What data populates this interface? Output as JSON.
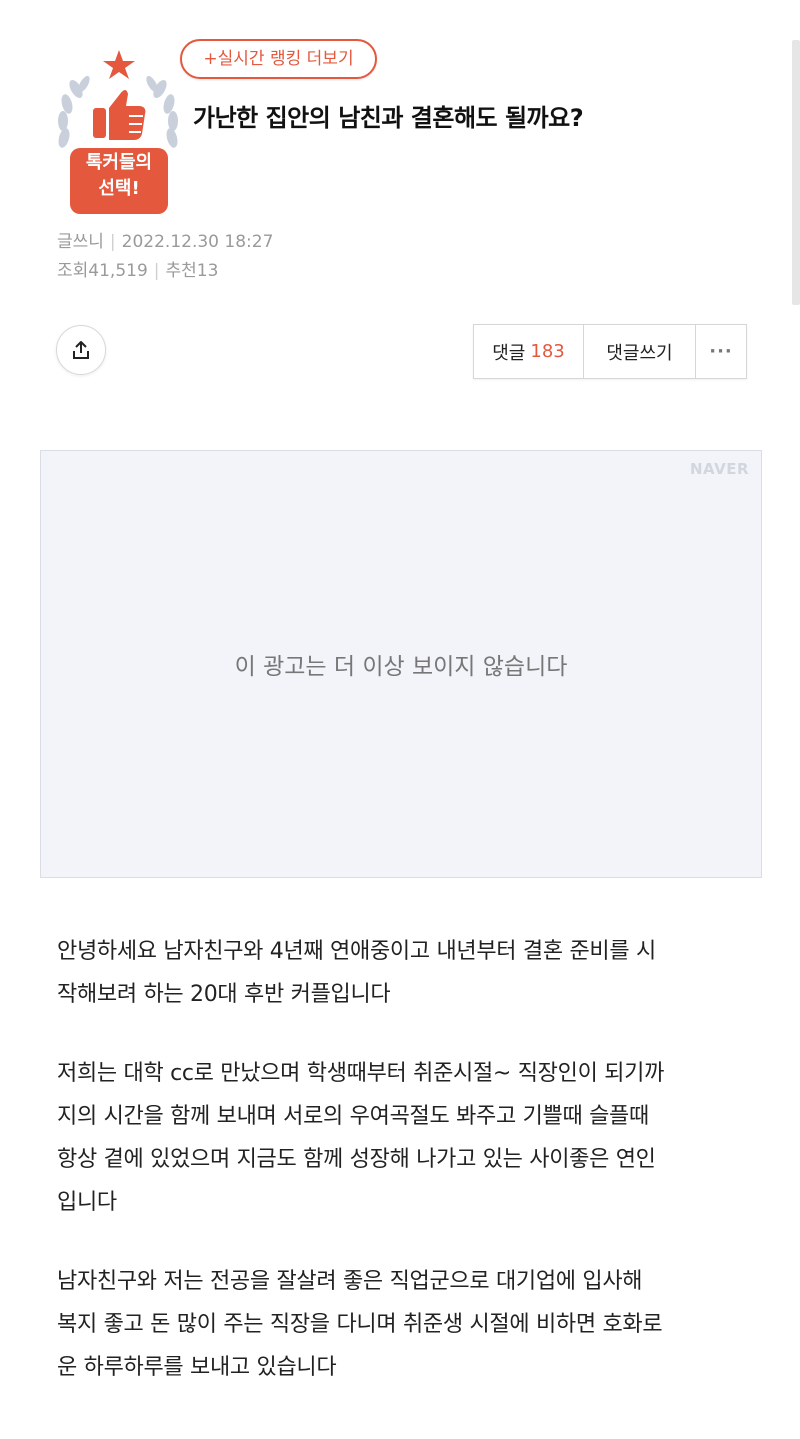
{
  "badge": {
    "line1": "톡커들의",
    "line2": "선택!"
  },
  "ranking_button": "+실시간 랭킹 더보기",
  "post": {
    "title": "가난한 집안의 남친과 결혼해도 될까요?",
    "author_label": "글쓰니",
    "date": "2022.12.30 18:27",
    "views": "조회41,519",
    "recommend": "추천13"
  },
  "actions": {
    "comments_label": "댓글",
    "comments_count": "183",
    "write_comment": "댓글쓰기",
    "more": "···"
  },
  "ad": {
    "logo": "NAVER",
    "message": "이 광고는 더 이상 보이지 않습니다"
  },
  "content": {
    "paragraphs": [
      [
        "안녕하세요 남자친구와 4년째 연애중이고 내년부터 결혼 준비를 시",
        "작해보려 하는 20대 후반 커플입니다"
      ],
      [
        "저희는 대학 cc로 만났으며 학생때부터 취준시절~ 직장인이 되기까",
        "지의 시간을 함께 보내며 서로의 우여곡절도 봐주고 기쁠때 슬플때",
        "항상 곁에 있었으며 지금도 함께 성장해 나가고 있는 사이좋은 연인",
        "입니다"
      ],
      [
        "남자친구와 저는 전공을 잘살려 좋은 직업군으로 대기업에 입사해",
        "복지 좋고 돈 많이 주는 직장을 다니며 취준생 시절에 비하면 호화로",
        "운 하루하루를 보내고 있습니다"
      ]
    ]
  },
  "colors": {
    "accent": "#e4583e",
    "meta": "#9a9a9a",
    "ad_bg": "#f2f4f9"
  }
}
